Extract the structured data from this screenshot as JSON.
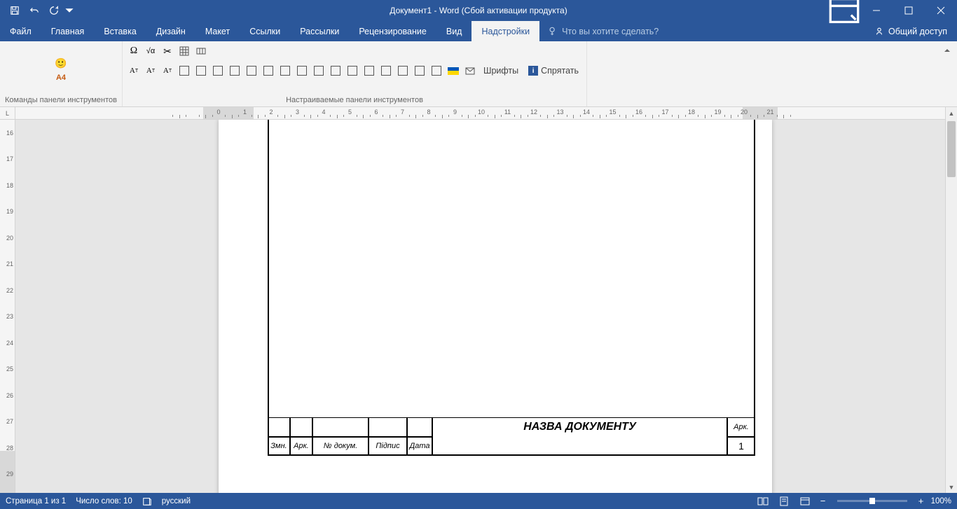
{
  "title": "Документ1 - Word (Сбой активации продукта)",
  "tabs": {
    "file": "Файл",
    "home": "Главная",
    "insert": "Вставка",
    "design": "Дизайн",
    "layout": "Макет",
    "references": "Ссылки",
    "mailings": "Рассылки",
    "review": "Рецензирование",
    "view": "Вид",
    "addins": "Надстройки"
  },
  "tell_me": "Что вы хотите сделать?",
  "share": "Общий доступ",
  "ribbon": {
    "group1_label": "Команды панели инструментов",
    "group2_label": "Настраиваемые панели инструментов",
    "a4": "А4",
    "fonts": "Шрифты",
    "hide": "Спрятать"
  },
  "document": {
    "title": "НАЗВА ДОКУМЕНТУ",
    "headers": {
      "zmn": "Змн.",
      "ark": "Арк.",
      "ndokum": "№ докум.",
      "pidpys": "Підпис",
      "data": "Дата",
      "ark_right": "Арк.",
      "page_num": "1"
    }
  },
  "status": {
    "page": "Страница 1 из 1",
    "words": "Число слов: 10",
    "lang": "русский",
    "zoom": "100%"
  }
}
